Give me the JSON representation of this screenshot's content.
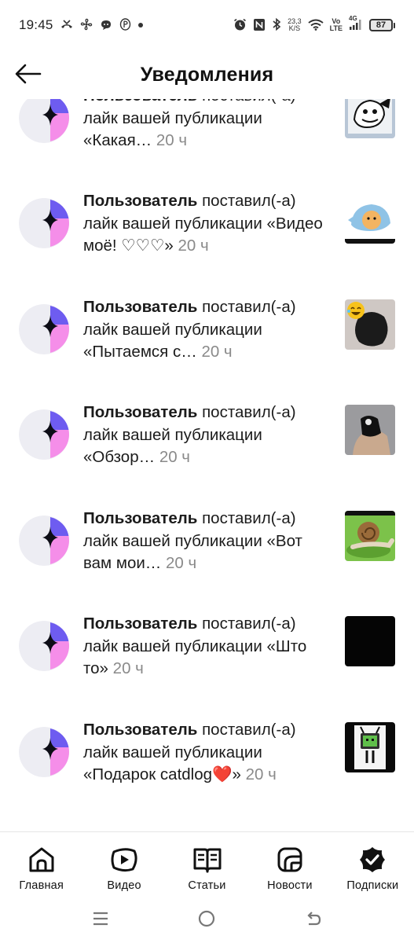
{
  "status_bar": {
    "time": "19:45",
    "net_speed_value": "23,3",
    "net_speed_unit": "K/S",
    "volte_top": "Vo",
    "volte_bottom": "LTE",
    "signal_label": "4G",
    "battery": "87",
    "icons": [
      "missed-call-icon",
      "fan-icon",
      "chat-bubble-icon",
      "coin-icon",
      "dot-icon",
      "alarm-icon",
      "nfc-icon",
      "bluetooth-icon",
      "wifi-icon",
      "signal-icon",
      "battery-icon"
    ]
  },
  "header": {
    "title": "Уведомления",
    "back_icon": "arrow-left-icon"
  },
  "notifications": [
    {
      "user": "Пользователь",
      "action": " поставил(-а) лайк вашей публикации ",
      "post": "«Какая…",
      "time": "20 ч",
      "thumb": "meme-drawing"
    },
    {
      "user": "Пользователь",
      "action": " поставил(-а) лайк вашей публикации ",
      "post": "«Видео моё! ♡♡♡»",
      "time": "20 ч",
      "thumb": "cat-in-shark-costume"
    },
    {
      "user": "Пользователь",
      "action": " поставил(-а) лайк вашей публикации ",
      "post": "«Пытаемся с…",
      "time": "20 ч",
      "thumb": "laughing-emoji-black-cat"
    },
    {
      "user": "Пользователь",
      "action": " поставил(-а) лайк вашей публикации ",
      "post": "«Обзор…",
      "time": "20 ч",
      "thumb": "hand-with-object"
    },
    {
      "user": "Пользователь",
      "action": " поставил(-а) лайк вашей публикации ",
      "post": "«Вот вам мои…",
      "time": "20 ч",
      "thumb": "snail-on-leaf"
    },
    {
      "user": "Пользователь",
      "action": " поставил(-а) лайк вашей публикации ",
      "post": "«Што то»",
      "time": "20 ч",
      "thumb": "black-square"
    },
    {
      "user": "Пользователь",
      "action": " поставил(-а) лайк вашей публикации ",
      "post": "«Подарок catdlog❤️»",
      "time": "20 ч",
      "thumb": "tv-head-robot"
    }
  ],
  "bottom_nav": [
    {
      "label": "Главная",
      "icon": "home-icon"
    },
    {
      "label": "Видео",
      "icon": "video-play-icon"
    },
    {
      "label": "Статьи",
      "icon": "open-book-icon"
    },
    {
      "label": "Новости",
      "icon": "news-icon"
    },
    {
      "label": "Подписки",
      "icon": "subscriptions-icon"
    }
  ],
  "system_nav": {
    "icons": [
      "menu-icon",
      "home-circle-icon",
      "back-icon"
    ]
  },
  "colors": {
    "avatar_bg": "#ededf3",
    "avatar_purple": "#6e5cf0",
    "avatar_pink": "#f58ee9",
    "time_gray": "#8a8a8a",
    "text": "#1b1b1b"
  }
}
